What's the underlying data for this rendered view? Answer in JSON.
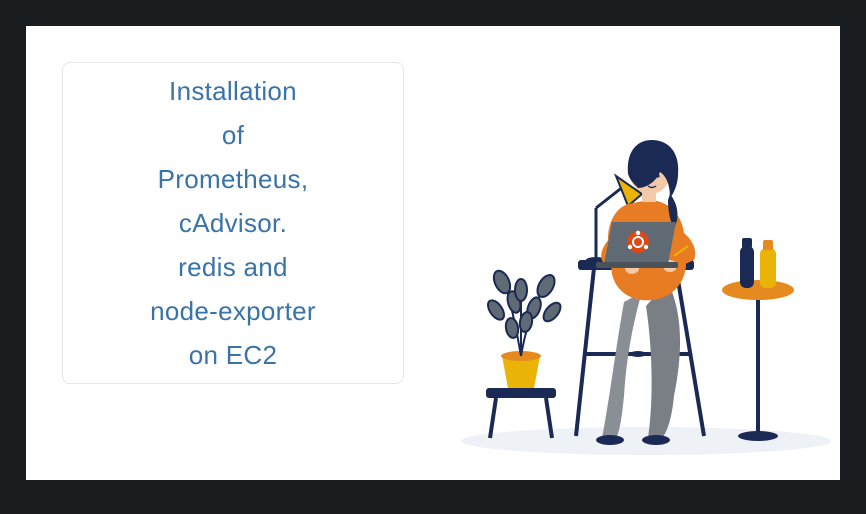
{
  "title_lines": [
    "Installation",
    "of",
    "Prometheus,",
    "cAdvisor.",
    "redis and",
    "node-exporter",
    "on EC2"
  ],
  "illustration_alt": "Woman working on laptop at high desk with plant and bottles"
}
